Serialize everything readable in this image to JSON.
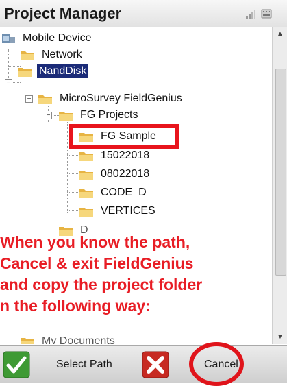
{
  "title": "Project Manager",
  "tree": {
    "mobile_device": "Mobile Device",
    "network": "Network",
    "nanddisk": "NandDisk",
    "microsurvey": "MicroSurvey FieldGenius",
    "fg_projects": "FG Projects",
    "fg_sample": "FG Sample",
    "p15022018": "15022018",
    "p08022018": "08022018",
    "code_d": "CODE_D",
    "vertices": "VERTICES",
    "partial_d": "D",
    "my_documents": "My Documents"
  },
  "instruction": {
    "line1": "When you know the path,",
    "line2": "Cancel & exit FieldGenius",
    "line3": "and copy the project folder",
    "line4": "n the following way:"
  },
  "buttons": {
    "select_path": "Select Path",
    "cancel": "Cancel"
  },
  "colors": {
    "selection": "#1b2b78",
    "annotation_red": "#e81d25",
    "folder_yellow": "#f2c14e"
  }
}
